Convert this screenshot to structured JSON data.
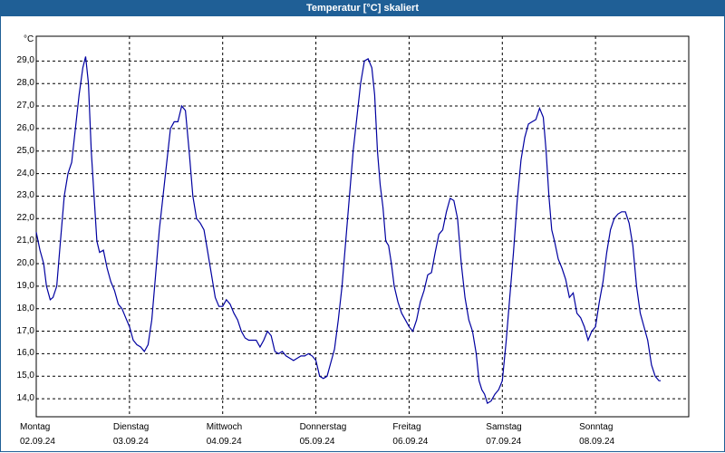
{
  "title": "Temperatur [°C] skaliert",
  "colors": {
    "titlebar": "#1f5f96",
    "line": "#0000a0",
    "grid": "#000000"
  },
  "chart_data": {
    "type": "line",
    "title": "Temperatur [°C] skaliert",
    "ylabel": "°C",
    "ylim": [
      13.2,
      30.1
    ],
    "xlim": [
      0,
      7
    ],
    "grid": true,
    "yticks": [
      "29,0",
      "28,0",
      "27,0",
      "26,0",
      "25,0",
      "24,0",
      "23,0",
      "22,0",
      "21,0",
      "20,0",
      "19,0",
      "18,0",
      "17,0",
      "16,0",
      "15,0",
      "14,0"
    ],
    "xticks": [
      {
        "day": "Montag",
        "date": "02.09.24"
      },
      {
        "day": "Dienstag",
        "date": "03.09.24"
      },
      {
        "day": "Mittwoch",
        "date": "04.09.24"
      },
      {
        "day": "Donnerstag",
        "date": "05.09.24"
      },
      {
        "day": "Freitag",
        "date": "06.09.24"
      },
      {
        "day": "Samstag",
        "date": "07.09.24"
      },
      {
        "day": "Sonntag",
        "date": "08.09.24"
      }
    ],
    "series": [
      {
        "points": [
          [
            0.0,
            21.4
          ],
          [
            0.04,
            20.6
          ],
          [
            0.08,
            20.0
          ],
          [
            0.11,
            19.0
          ],
          [
            0.15,
            18.4
          ],
          [
            0.18,
            18.5
          ],
          [
            0.22,
            19.0
          ],
          [
            0.26,
            21.0
          ],
          [
            0.3,
            23.0
          ],
          [
            0.34,
            24.0
          ],
          [
            0.38,
            24.5
          ],
          [
            0.42,
            26.0
          ],
          [
            0.46,
            27.5
          ],
          [
            0.5,
            28.7
          ],
          [
            0.53,
            29.2
          ],
          [
            0.56,
            28.0
          ],
          [
            0.59,
            25.0
          ],
          [
            0.62,
            23.0
          ],
          [
            0.65,
            21.0
          ],
          [
            0.68,
            20.5
          ],
          [
            0.72,
            20.6
          ],
          [
            0.76,
            19.8
          ],
          [
            0.8,
            19.2
          ],
          [
            0.84,
            18.8
          ],
          [
            0.88,
            18.2
          ],
          [
            0.92,
            18.0
          ],
          [
            0.96,
            17.6
          ],
          [
            1.0,
            17.2
          ],
          [
            1.04,
            16.6
          ],
          [
            1.08,
            16.4
          ],
          [
            1.12,
            16.3
          ],
          [
            1.16,
            16.1
          ],
          [
            1.2,
            16.4
          ],
          [
            1.24,
            17.5
          ],
          [
            1.28,
            19.5
          ],
          [
            1.32,
            21.5
          ],
          [
            1.36,
            23.0
          ],
          [
            1.4,
            24.5
          ],
          [
            1.44,
            26.0
          ],
          [
            1.48,
            26.3
          ],
          [
            1.52,
            26.3
          ],
          [
            1.56,
            27.0
          ],
          [
            1.6,
            26.8
          ],
          [
            1.64,
            25.0
          ],
          [
            1.68,
            23.0
          ],
          [
            1.72,
            22.0
          ],
          [
            1.76,
            21.8
          ],
          [
            1.8,
            21.5
          ],
          [
            1.84,
            20.5
          ],
          [
            1.88,
            19.5
          ],
          [
            1.92,
            18.5
          ],
          [
            1.96,
            18.1
          ],
          [
            2.0,
            18.1
          ],
          [
            2.04,
            18.4
          ],
          [
            2.08,
            18.2
          ],
          [
            2.12,
            17.8
          ],
          [
            2.16,
            17.5
          ],
          [
            2.2,
            17.0
          ],
          [
            2.24,
            16.7
          ],
          [
            2.28,
            16.6
          ],
          [
            2.32,
            16.6
          ],
          [
            2.36,
            16.6
          ],
          [
            2.4,
            16.3
          ],
          [
            2.44,
            16.6
          ],
          [
            2.48,
            17.0
          ],
          [
            2.52,
            16.8
          ],
          [
            2.56,
            16.1
          ],
          [
            2.6,
            16.0
          ],
          [
            2.64,
            16.1
          ],
          [
            2.68,
            15.9
          ],
          [
            2.72,
            15.8
          ],
          [
            2.76,
            15.7
          ],
          [
            2.8,
            15.8
          ],
          [
            2.84,
            15.9
          ],
          [
            2.88,
            15.9
          ],
          [
            2.92,
            16.0
          ],
          [
            2.96,
            15.9
          ],
          [
            3.0,
            15.7
          ],
          [
            3.04,
            15.0
          ],
          [
            3.08,
            14.9
          ],
          [
            3.12,
            15.0
          ],
          [
            3.16,
            15.6
          ],
          [
            3.2,
            16.2
          ],
          [
            3.24,
            17.5
          ],
          [
            3.28,
            19.0
          ],
          [
            3.32,
            21.0
          ],
          [
            3.36,
            23.0
          ],
          [
            3.4,
            25.0
          ],
          [
            3.44,
            26.5
          ],
          [
            3.48,
            28.0
          ],
          [
            3.52,
            29.0
          ],
          [
            3.56,
            29.1
          ],
          [
            3.6,
            28.7
          ],
          [
            3.63,
            27.5
          ],
          [
            3.66,
            25.0
          ],
          [
            3.69,
            23.5
          ],
          [
            3.72,
            22.5
          ],
          [
            3.75,
            21.0
          ],
          [
            3.78,
            20.8
          ],
          [
            3.81,
            20.0
          ],
          [
            3.84,
            19.0
          ],
          [
            3.88,
            18.3
          ],
          [
            3.92,
            17.8
          ],
          [
            3.96,
            17.5
          ],
          [
            4.0,
            17.2
          ],
          [
            4.04,
            17.0
          ],
          [
            4.08,
            17.5
          ],
          [
            4.12,
            18.3
          ],
          [
            4.16,
            18.8
          ],
          [
            4.2,
            19.5
          ],
          [
            4.24,
            19.6
          ],
          [
            4.28,
            20.5
          ],
          [
            4.32,
            21.3
          ],
          [
            4.36,
            21.5
          ],
          [
            4.4,
            22.3
          ],
          [
            4.44,
            22.9
          ],
          [
            4.48,
            22.8
          ],
          [
            4.52,
            22.0
          ],
          [
            4.56,
            20.0
          ],
          [
            4.6,
            18.5
          ],
          [
            4.64,
            17.5
          ],
          [
            4.68,
            17.0
          ],
          [
            4.72,
            16.0
          ],
          [
            4.75,
            14.8
          ],
          [
            4.78,
            14.4
          ],
          [
            4.81,
            14.2
          ],
          [
            4.84,
            13.8
          ],
          [
            4.88,
            13.9
          ],
          [
            4.92,
            14.2
          ],
          [
            4.96,
            14.4
          ],
          [
            5.0,
            14.8
          ],
          [
            5.04,
            16.5
          ],
          [
            5.08,
            18.5
          ],
          [
            5.12,
            20.5
          ],
          [
            5.16,
            22.8
          ],
          [
            5.2,
            24.6
          ],
          [
            5.24,
            25.6
          ],
          [
            5.28,
            26.2
          ],
          [
            5.32,
            26.3
          ],
          [
            5.36,
            26.4
          ],
          [
            5.4,
            26.9
          ],
          [
            5.44,
            26.5
          ],
          [
            5.47,
            25.0
          ],
          [
            5.5,
            23.0
          ],
          [
            5.53,
            21.5
          ],
          [
            5.56,
            21.0
          ],
          [
            5.6,
            20.2
          ],
          [
            5.64,
            19.8
          ],
          [
            5.68,
            19.3
          ],
          [
            5.72,
            18.5
          ],
          [
            5.76,
            18.7
          ],
          [
            5.8,
            17.8
          ],
          [
            5.84,
            17.6
          ],
          [
            5.88,
            17.2
          ],
          [
            5.92,
            16.6
          ],
          [
            5.96,
            17.0
          ],
          [
            6.0,
            17.2
          ],
          [
            6.04,
            18.3
          ],
          [
            6.08,
            19.2
          ],
          [
            6.12,
            20.5
          ],
          [
            6.16,
            21.5
          ],
          [
            6.2,
            22.0
          ],
          [
            6.24,
            22.2
          ],
          [
            6.28,
            22.3
          ],
          [
            6.32,
            22.3
          ],
          [
            6.36,
            21.8
          ],
          [
            6.4,
            20.8
          ],
          [
            6.44,
            19.0
          ],
          [
            6.48,
            17.8
          ],
          [
            6.52,
            17.2
          ],
          [
            6.56,
            16.6
          ],
          [
            6.6,
            15.5
          ],
          [
            6.64,
            15.0
          ],
          [
            6.68,
            14.8
          ],
          [
            6.7,
            14.8
          ]
        ]
      }
    ]
  }
}
